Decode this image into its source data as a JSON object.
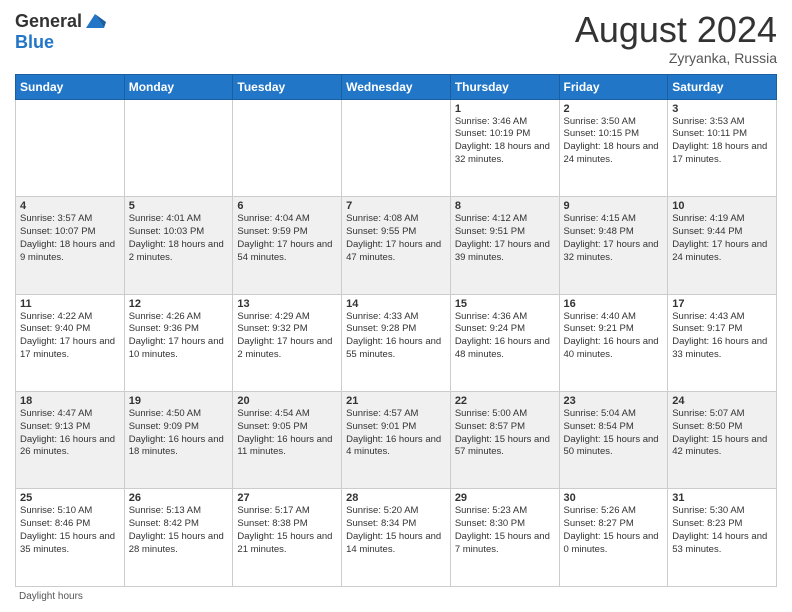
{
  "header": {
    "logo_general": "General",
    "logo_blue": "Blue",
    "month_title": "August 2024",
    "location": "Zyryanka, Russia"
  },
  "weekdays": [
    "Sunday",
    "Monday",
    "Tuesday",
    "Wednesday",
    "Thursday",
    "Friday",
    "Saturday"
  ],
  "footer": "Daylight hours",
  "weeks": [
    [
      {
        "day": "",
        "sunrise": "",
        "sunset": "",
        "daylight": ""
      },
      {
        "day": "",
        "sunrise": "",
        "sunset": "",
        "daylight": ""
      },
      {
        "day": "",
        "sunrise": "",
        "sunset": "",
        "daylight": ""
      },
      {
        "day": "",
        "sunrise": "",
        "sunset": "",
        "daylight": ""
      },
      {
        "day": "1",
        "sunrise": "Sunrise: 3:46 AM",
        "sunset": "Sunset: 10:19 PM",
        "daylight": "Daylight: 18 hours and 32 minutes."
      },
      {
        "day": "2",
        "sunrise": "Sunrise: 3:50 AM",
        "sunset": "Sunset: 10:15 PM",
        "daylight": "Daylight: 18 hours and 24 minutes."
      },
      {
        "day": "3",
        "sunrise": "Sunrise: 3:53 AM",
        "sunset": "Sunset: 10:11 PM",
        "daylight": "Daylight: 18 hours and 17 minutes."
      }
    ],
    [
      {
        "day": "4",
        "sunrise": "Sunrise: 3:57 AM",
        "sunset": "Sunset: 10:07 PM",
        "daylight": "Daylight: 18 hours and 9 minutes."
      },
      {
        "day": "5",
        "sunrise": "Sunrise: 4:01 AM",
        "sunset": "Sunset: 10:03 PM",
        "daylight": "Daylight: 18 hours and 2 minutes."
      },
      {
        "day": "6",
        "sunrise": "Sunrise: 4:04 AM",
        "sunset": "Sunset: 9:59 PM",
        "daylight": "Daylight: 17 hours and 54 minutes."
      },
      {
        "day": "7",
        "sunrise": "Sunrise: 4:08 AM",
        "sunset": "Sunset: 9:55 PM",
        "daylight": "Daylight: 17 hours and 47 minutes."
      },
      {
        "day": "8",
        "sunrise": "Sunrise: 4:12 AM",
        "sunset": "Sunset: 9:51 PM",
        "daylight": "Daylight: 17 hours and 39 minutes."
      },
      {
        "day": "9",
        "sunrise": "Sunrise: 4:15 AM",
        "sunset": "Sunset: 9:48 PM",
        "daylight": "Daylight: 17 hours and 32 minutes."
      },
      {
        "day": "10",
        "sunrise": "Sunrise: 4:19 AM",
        "sunset": "Sunset: 9:44 PM",
        "daylight": "Daylight: 17 hours and 24 minutes."
      }
    ],
    [
      {
        "day": "11",
        "sunrise": "Sunrise: 4:22 AM",
        "sunset": "Sunset: 9:40 PM",
        "daylight": "Daylight: 17 hours and 17 minutes."
      },
      {
        "day": "12",
        "sunrise": "Sunrise: 4:26 AM",
        "sunset": "Sunset: 9:36 PM",
        "daylight": "Daylight: 17 hours and 10 minutes."
      },
      {
        "day": "13",
        "sunrise": "Sunrise: 4:29 AM",
        "sunset": "Sunset: 9:32 PM",
        "daylight": "Daylight: 17 hours and 2 minutes."
      },
      {
        "day": "14",
        "sunrise": "Sunrise: 4:33 AM",
        "sunset": "Sunset: 9:28 PM",
        "daylight": "Daylight: 16 hours and 55 minutes."
      },
      {
        "day": "15",
        "sunrise": "Sunrise: 4:36 AM",
        "sunset": "Sunset: 9:24 PM",
        "daylight": "Daylight: 16 hours and 48 minutes."
      },
      {
        "day": "16",
        "sunrise": "Sunrise: 4:40 AM",
        "sunset": "Sunset: 9:21 PM",
        "daylight": "Daylight: 16 hours and 40 minutes."
      },
      {
        "day": "17",
        "sunrise": "Sunrise: 4:43 AM",
        "sunset": "Sunset: 9:17 PM",
        "daylight": "Daylight: 16 hours and 33 minutes."
      }
    ],
    [
      {
        "day": "18",
        "sunrise": "Sunrise: 4:47 AM",
        "sunset": "Sunset: 9:13 PM",
        "daylight": "Daylight: 16 hours and 26 minutes."
      },
      {
        "day": "19",
        "sunrise": "Sunrise: 4:50 AM",
        "sunset": "Sunset: 9:09 PM",
        "daylight": "Daylight: 16 hours and 18 minutes."
      },
      {
        "day": "20",
        "sunrise": "Sunrise: 4:54 AM",
        "sunset": "Sunset: 9:05 PM",
        "daylight": "Daylight: 16 hours and 11 minutes."
      },
      {
        "day": "21",
        "sunrise": "Sunrise: 4:57 AM",
        "sunset": "Sunset: 9:01 PM",
        "daylight": "Daylight: 16 hours and 4 minutes."
      },
      {
        "day": "22",
        "sunrise": "Sunrise: 5:00 AM",
        "sunset": "Sunset: 8:57 PM",
        "daylight": "Daylight: 15 hours and 57 minutes."
      },
      {
        "day": "23",
        "sunrise": "Sunrise: 5:04 AM",
        "sunset": "Sunset: 8:54 PM",
        "daylight": "Daylight: 15 hours and 50 minutes."
      },
      {
        "day": "24",
        "sunrise": "Sunrise: 5:07 AM",
        "sunset": "Sunset: 8:50 PM",
        "daylight": "Daylight: 15 hours and 42 minutes."
      }
    ],
    [
      {
        "day": "25",
        "sunrise": "Sunrise: 5:10 AM",
        "sunset": "Sunset: 8:46 PM",
        "daylight": "Daylight: 15 hours and 35 minutes."
      },
      {
        "day": "26",
        "sunrise": "Sunrise: 5:13 AM",
        "sunset": "Sunset: 8:42 PM",
        "daylight": "Daylight: 15 hours and 28 minutes."
      },
      {
        "day": "27",
        "sunrise": "Sunrise: 5:17 AM",
        "sunset": "Sunset: 8:38 PM",
        "daylight": "Daylight: 15 hours and 21 minutes."
      },
      {
        "day": "28",
        "sunrise": "Sunrise: 5:20 AM",
        "sunset": "Sunset: 8:34 PM",
        "daylight": "Daylight: 15 hours and 14 minutes."
      },
      {
        "day": "29",
        "sunrise": "Sunrise: 5:23 AM",
        "sunset": "Sunset: 8:30 PM",
        "daylight": "Daylight: 15 hours and 7 minutes."
      },
      {
        "day": "30",
        "sunrise": "Sunrise: 5:26 AM",
        "sunset": "Sunset: 8:27 PM",
        "daylight": "Daylight: 15 hours and 0 minutes."
      },
      {
        "day": "31",
        "sunrise": "Sunrise: 5:30 AM",
        "sunset": "Sunset: 8:23 PM",
        "daylight": "Daylight: 14 hours and 53 minutes."
      }
    ]
  ]
}
